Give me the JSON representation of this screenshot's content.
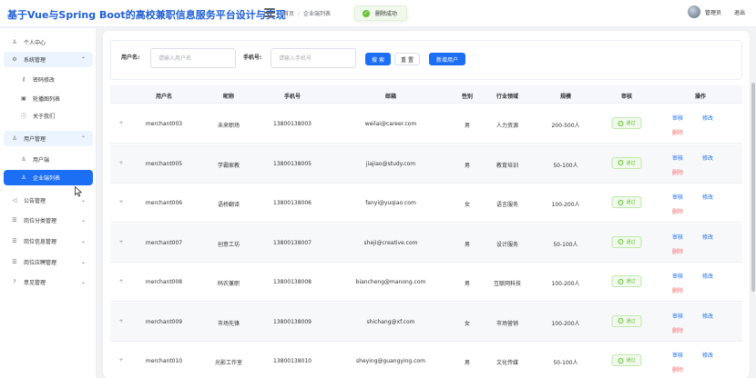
{
  "header": {
    "title": "基于Vue与Spring Boot的高校兼职信息服务平台设计与实现",
    "breadcrumb": [
      "首页",
      "企业端列表"
    ],
    "toast": "删除成功",
    "user_name": "管理员",
    "logout": "退出"
  },
  "sidebar": {
    "items": [
      {
        "label": "个人中心",
        "icon": "user-icon"
      },
      {
        "label": "系统管理",
        "icon": "gear-icon",
        "open": true
      },
      {
        "label": "密码修改",
        "icon": "key-icon"
      },
      {
        "label": "轮播图列表",
        "icon": "image-icon"
      },
      {
        "label": "关于我们",
        "icon": "info-icon"
      },
      {
        "label": "用户管理",
        "icon": "user-icon",
        "open": true
      },
      {
        "label": "用户端",
        "icon": "user-icon"
      },
      {
        "label": "企业端列表",
        "icon": "user-icon",
        "active": true
      },
      {
        "label": "公告管理",
        "icon": "speaker-icon"
      },
      {
        "label": "岗位分类管理",
        "icon": "list-icon"
      },
      {
        "label": "岗位信息管理",
        "icon": "list-icon"
      },
      {
        "label": "岗位应聘管理",
        "icon": "list-icon"
      },
      {
        "label": "意见管理",
        "icon": "question-icon"
      }
    ]
  },
  "search": {
    "username_label": "用户名:",
    "username_placeholder": "请输入用户名",
    "phone_label": "手机号:",
    "phone_placeholder": "请输入手机号",
    "search_btn": "搜 索",
    "reset_btn": "重 置",
    "add_btn": "新增用户"
  },
  "table": {
    "columns": [
      "用户名",
      "昵称",
      "手机号",
      "邮箱",
      "性别",
      "行业领域",
      "规模",
      "审核",
      "操作"
    ],
    "expand_symbol": "+",
    "status_label": "通过",
    "action_review": "审核",
    "action_edit": "修改",
    "action_delete": "删除",
    "rows": [
      {
        "username": "merchant003",
        "nickname": "未来职场",
        "phone": "13800138003",
        "email": "weilai@career.com",
        "gender": "男",
        "industry": "人力资源",
        "scale": "200-500人"
      },
      {
        "username": "merchant005",
        "nickname": "学霸家教",
        "phone": "13800138005",
        "email": "jiajiao@study.com",
        "gender": "男",
        "industry": "教育培训",
        "scale": "50-100人"
      },
      {
        "username": "merchant006",
        "nickname": "语桥翻译",
        "phone": "13800138006",
        "email": "fanyi@yuqiao.com",
        "gender": "女",
        "industry": "语言服务",
        "scale": "100-200人"
      },
      {
        "username": "merchant007",
        "nickname": "创意工坊",
        "phone": "13800138007",
        "email": "sheji@creative.com",
        "gender": "男",
        "industry": "设计服务",
        "scale": "50-100人"
      },
      {
        "username": "merchant008",
        "nickname": "码农兼职",
        "phone": "13800138008",
        "email": "biancheng@manong.com",
        "gender": "男",
        "industry": "互联网科技",
        "scale": "100-200人"
      },
      {
        "username": "merchant009",
        "nickname": "市场先锋",
        "phone": "13800138009",
        "email": "shichang@xf.com",
        "gender": "女",
        "industry": "市场营销",
        "scale": "100-200人"
      },
      {
        "username": "merchant010",
        "nickname": "光影工作室",
        "phone": "13800138010",
        "email": "sheying@guangying.com",
        "gender": "男",
        "industry": "文化传媒",
        "scale": "50-100人"
      }
    ]
  },
  "colors": {
    "primary": "#1c6ef3",
    "success": "#67c23a",
    "danger": "#f56c6c",
    "title": "#1f5fd6"
  }
}
